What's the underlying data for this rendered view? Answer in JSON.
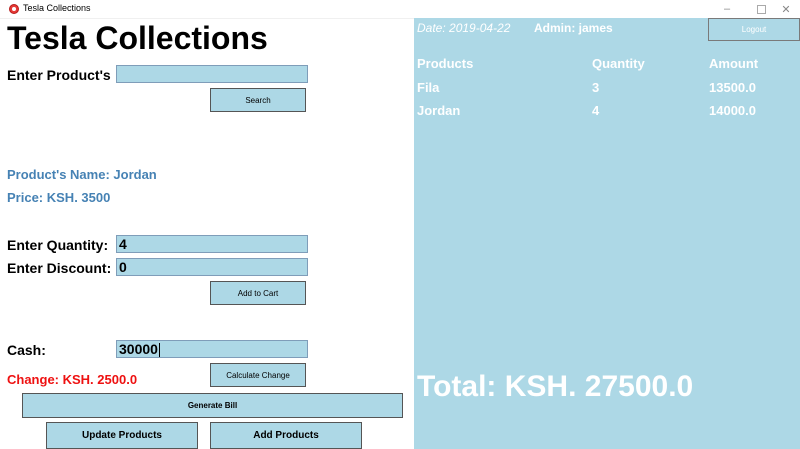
{
  "window": {
    "title": "Tesla Collections",
    "minimize": "–",
    "close": "✕"
  },
  "app_title": "Tesla Collections",
  "search": {
    "label": "Enter Product's",
    "value": "",
    "button": "Search"
  },
  "product": {
    "name_text": "Product's Name: Jordan",
    "price_text": "Price: KSH. 3500"
  },
  "quantity": {
    "label": "Enter Quantity:",
    "value": "4"
  },
  "discount": {
    "label": "Enter Discount:",
    "value": "0"
  },
  "add_to_cart": "Add to Cart",
  "cash": {
    "label": "Cash:",
    "value": "30000"
  },
  "change_text": "Change: KSH. 2500.0",
  "calculate_change": "Calculate Change",
  "generate_bill": "Generate Bill",
  "update_products": "Update Products",
  "add_products": "Add Products",
  "header": {
    "date": "Date: 2019-04-22",
    "admin": "Admin: james",
    "logout": "Logout"
  },
  "cart": {
    "columns": [
      "Products",
      "Quantity",
      "Amount"
    ],
    "rows": [
      [
        "Fila",
        "3",
        "13500.0"
      ],
      [
        "Jordan",
        "4",
        "14000.0"
      ]
    ]
  },
  "total": "Total: KSH. 27500.0",
  "colors": {
    "panel": "#add8e6",
    "info": "#4682b4",
    "change": "#ee1111"
  }
}
